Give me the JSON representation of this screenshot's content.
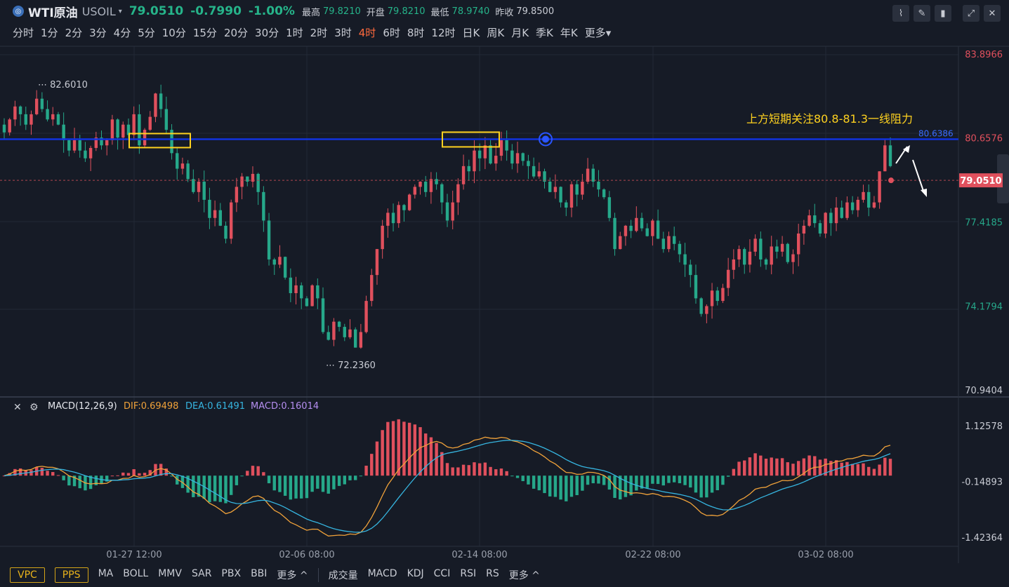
{
  "header": {
    "logo_glyph": "◎",
    "symbol_name": "WTI原油",
    "symbol_code": "USOIL",
    "dropdown_glyph": "▾",
    "last_price": "79.0510",
    "change": "-0.7990",
    "change_pct": "-1.00%",
    "high_label": "最高",
    "high_value": "79.8210",
    "open_label": "开盘",
    "open_value": "79.8210",
    "low_label": "最低",
    "low_value": "78.9740",
    "prev_close_label": "昨收",
    "prev_close_value": "79.8500"
  },
  "timeframes": [
    "分时",
    "1分",
    "2分",
    "3分",
    "4分",
    "5分",
    "10分",
    "15分",
    "20分",
    "30分",
    "1时",
    "2时",
    "3时",
    "4时",
    "6时",
    "8时",
    "12时",
    "日K",
    "周K",
    "月K",
    "季K",
    "年K",
    "更多▾"
  ],
  "active_timeframe": "4时",
  "toolbar_icons": [
    "chart-style-icon",
    "draw-icon",
    "candle-type-icon",
    "fullscreen-icon",
    "close-icon"
  ],
  "chart_data": [
    {
      "type": "candlestick",
      "y_axis_ticks": [
        "83.8966",
        "80.6576",
        "77.4185",
        "74.1794",
        "70.9404"
      ],
      "y_tick_values": [
        83.8966,
        80.6576,
        77.4185,
        74.1794,
        70.9404
      ],
      "x_axis_labels": [
        "01-27 12:00",
        "02-06 08:00",
        "02-14 08:00",
        "02-22 08:00",
        "03-02 08:00"
      ],
      "high_marker": "82.6010",
      "low_marker": "72.2360",
      "last_price_label": "79.0510",
      "horizontal_line_value": 80.6386,
      "horizontal_line_label": "80.6386",
      "annotation": "上方短期关注80.8-81.3一线阻力",
      "close_series": [
        80.9,
        81.4,
        81.9,
        81.6,
        81.2,
        81.6,
        82.2,
        81.8,
        81.4,
        81.6,
        81.2,
        80.6,
        80.2,
        80.6,
        80.2,
        79.9,
        80.3,
        80.7,
        80.4,
        80.6,
        81.4,
        80.7,
        81.2,
        80.8,
        81.6,
        80.4,
        81.0,
        81.5,
        82.4,
        81.8,
        81.0,
        80.1,
        79.5,
        79.7,
        79.1,
        78.6,
        79.0,
        78.3,
        77.6,
        77.9,
        77.3,
        76.8,
        78.2,
        78.8,
        79.2,
        79.0,
        79.3,
        78.6,
        77.5,
        76.0,
        75.8,
        76.1,
        75.3,
        74.7,
        75.0,
        74.5,
        74.2,
        75.0,
        74.5,
        73.2,
        72.9,
        73.6,
        73.4,
        73.0,
        73.3,
        72.6,
        73.2,
        74.4,
        75.4,
        76.4,
        77.3,
        77.8,
        77.4,
        78.1,
        77.9,
        78.5,
        78.8,
        79.0,
        78.6,
        79.1,
        78.9,
        78.2,
        77.5,
        78.2,
        78.9,
        79.6,
        79.4,
        80.2,
        79.9,
        80.4,
        79.7,
        80.0,
        80.6,
        80.2,
        79.7,
        80.1,
        79.8,
        79.6,
        79.2,
        79.4,
        79.0,
        78.6,
        78.8,
        78.2,
        78.0,
        78.9,
        78.5,
        79.0,
        79.5,
        79.0,
        78.7,
        78.4,
        77.6,
        76.4,
        76.9,
        77.3,
        77.1,
        77.6,
        77.2,
        76.9,
        77.5,
        76.8,
        76.4,
        76.9,
        76.6,
        76.2,
        75.8,
        75.4,
        74.5,
        73.9,
        74.2,
        74.8,
        74.4,
        74.9,
        75.6,
        76.0,
        76.4,
        75.8,
        76.3,
        76.8,
        76.0,
        75.8,
        76.5,
        76.3,
        76.6,
        75.9,
        76.2,
        77.0,
        77.3,
        77.7,
        77.4,
        77.0,
        77.8,
        77.4,
        78.0,
        77.6,
        78.2,
        77.9,
        78.3,
        78.6,
        78.0,
        78.2,
        79.4,
        80.4,
        79.6
      ]
    },
    {
      "type": "bar",
      "title": "MACD(12,26,9)",
      "dif_label": "DIF:0.69498",
      "dea_label": "DEA:0.61491",
      "macd_label": "MACD:0.16014",
      "y_axis_ticks": [
        "1.12578",
        "-0.14893",
        "-1.42364"
      ],
      "y_tick_values": [
        1.12578,
        -0.14893,
        -1.42364
      ],
      "dif": 0.69498,
      "dea": 0.61491,
      "macd": 0.16014
    }
  ],
  "bottom_bar": {
    "boxed": [
      "VPC",
      "PPS"
    ],
    "overlays": [
      "MA",
      "BOLL",
      "MMV",
      "SAR",
      "PBX",
      "BBI",
      "更多 ^"
    ],
    "indicators": [
      "成交量",
      "MACD",
      "KDJ",
      "CCI",
      "RSI",
      "RS",
      "更多 ^"
    ]
  },
  "colors": {
    "up": "#e0505d",
    "down": "#26a88a",
    "line": "#1133dd",
    "annotation": "#ffd21f",
    "dif": "#f0a23a",
    "dea": "#36b5e0",
    "macd": "#b58ef0"
  }
}
